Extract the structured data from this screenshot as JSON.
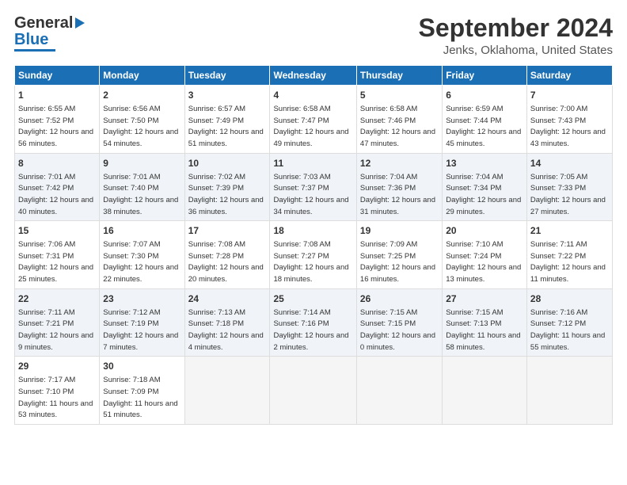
{
  "header": {
    "logo_line1": "General",
    "logo_line2": "Blue",
    "title": "September 2024",
    "subtitle": "Jenks, Oklahoma, United States"
  },
  "weekdays": [
    "Sunday",
    "Monday",
    "Tuesday",
    "Wednesday",
    "Thursday",
    "Friday",
    "Saturday"
  ],
  "weeks": [
    [
      {
        "day": "1",
        "sunrise": "6:55 AM",
        "sunset": "7:52 PM",
        "daylight": "12 hours and 56 minutes."
      },
      {
        "day": "2",
        "sunrise": "6:56 AM",
        "sunset": "7:50 PM",
        "daylight": "12 hours and 54 minutes."
      },
      {
        "day": "3",
        "sunrise": "6:57 AM",
        "sunset": "7:49 PM",
        "daylight": "12 hours and 51 minutes."
      },
      {
        "day": "4",
        "sunrise": "6:58 AM",
        "sunset": "7:47 PM",
        "daylight": "12 hours and 49 minutes."
      },
      {
        "day": "5",
        "sunrise": "6:58 AM",
        "sunset": "7:46 PM",
        "daylight": "12 hours and 47 minutes."
      },
      {
        "day": "6",
        "sunrise": "6:59 AM",
        "sunset": "7:44 PM",
        "daylight": "12 hours and 45 minutes."
      },
      {
        "day": "7",
        "sunrise": "7:00 AM",
        "sunset": "7:43 PM",
        "daylight": "12 hours and 43 minutes."
      }
    ],
    [
      {
        "day": "8",
        "sunrise": "7:01 AM",
        "sunset": "7:42 PM",
        "daylight": "12 hours and 40 minutes."
      },
      {
        "day": "9",
        "sunrise": "7:01 AM",
        "sunset": "7:40 PM",
        "daylight": "12 hours and 38 minutes."
      },
      {
        "day": "10",
        "sunrise": "7:02 AM",
        "sunset": "7:39 PM",
        "daylight": "12 hours and 36 minutes."
      },
      {
        "day": "11",
        "sunrise": "7:03 AM",
        "sunset": "7:37 PM",
        "daylight": "12 hours and 34 minutes."
      },
      {
        "day": "12",
        "sunrise": "7:04 AM",
        "sunset": "7:36 PM",
        "daylight": "12 hours and 31 minutes."
      },
      {
        "day": "13",
        "sunrise": "7:04 AM",
        "sunset": "7:34 PM",
        "daylight": "12 hours and 29 minutes."
      },
      {
        "day": "14",
        "sunrise": "7:05 AM",
        "sunset": "7:33 PM",
        "daylight": "12 hours and 27 minutes."
      }
    ],
    [
      {
        "day": "15",
        "sunrise": "7:06 AM",
        "sunset": "7:31 PM",
        "daylight": "12 hours and 25 minutes."
      },
      {
        "day": "16",
        "sunrise": "7:07 AM",
        "sunset": "7:30 PM",
        "daylight": "12 hours and 22 minutes."
      },
      {
        "day": "17",
        "sunrise": "7:08 AM",
        "sunset": "7:28 PM",
        "daylight": "12 hours and 20 minutes."
      },
      {
        "day": "18",
        "sunrise": "7:08 AM",
        "sunset": "7:27 PM",
        "daylight": "12 hours and 18 minutes."
      },
      {
        "day": "19",
        "sunrise": "7:09 AM",
        "sunset": "7:25 PM",
        "daylight": "12 hours and 16 minutes."
      },
      {
        "day": "20",
        "sunrise": "7:10 AM",
        "sunset": "7:24 PM",
        "daylight": "12 hours and 13 minutes."
      },
      {
        "day": "21",
        "sunrise": "7:11 AM",
        "sunset": "7:22 PM",
        "daylight": "12 hours and 11 minutes."
      }
    ],
    [
      {
        "day": "22",
        "sunrise": "7:11 AM",
        "sunset": "7:21 PM",
        "daylight": "12 hours and 9 minutes."
      },
      {
        "day": "23",
        "sunrise": "7:12 AM",
        "sunset": "7:19 PM",
        "daylight": "12 hours and 7 minutes."
      },
      {
        "day": "24",
        "sunrise": "7:13 AM",
        "sunset": "7:18 PM",
        "daylight": "12 hours and 4 minutes."
      },
      {
        "day": "25",
        "sunrise": "7:14 AM",
        "sunset": "7:16 PM",
        "daylight": "12 hours and 2 minutes."
      },
      {
        "day": "26",
        "sunrise": "7:15 AM",
        "sunset": "7:15 PM",
        "daylight": "12 hours and 0 minutes."
      },
      {
        "day": "27",
        "sunrise": "7:15 AM",
        "sunset": "7:13 PM",
        "daylight": "11 hours and 58 minutes."
      },
      {
        "day": "28",
        "sunrise": "7:16 AM",
        "sunset": "7:12 PM",
        "daylight": "11 hours and 55 minutes."
      }
    ],
    [
      {
        "day": "29",
        "sunrise": "7:17 AM",
        "sunset": "7:10 PM",
        "daylight": "11 hours and 53 minutes."
      },
      {
        "day": "30",
        "sunrise": "7:18 AM",
        "sunset": "7:09 PM",
        "daylight": "11 hours and 51 minutes."
      },
      null,
      null,
      null,
      null,
      null
    ]
  ],
  "labels": {
    "sunrise": "Sunrise:",
    "sunset": "Sunset:",
    "daylight": "Daylight:"
  }
}
